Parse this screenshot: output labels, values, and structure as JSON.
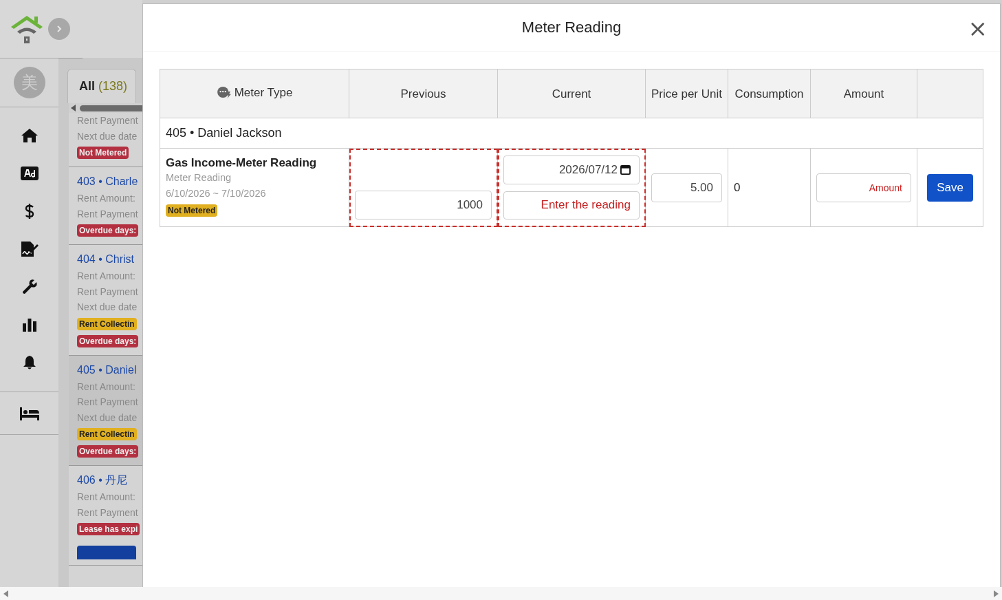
{
  "sidebar": {
    "avatar": "美"
  },
  "list": {
    "tabs": [
      {
        "label": "All",
        "count": "(138)",
        "selected": true
      }
    ],
    "cards": [
      {
        "lines": [
          "Rent Payment",
          "Next due date"
        ],
        "badges": [
          {
            "label": "Not Metered",
            "kind": "danger"
          }
        ],
        "selected": false,
        "button": false
      },
      {
        "title": "403 • Charle",
        "lines": [
          "Rent Amount:",
          "Rent Payment"
        ],
        "badges": [
          {
            "label": "Overdue days:",
            "kind": "danger"
          }
        ],
        "selected": false,
        "button": false
      },
      {
        "title": "404 • Christ",
        "lines": [
          "Rent Amount:",
          "Rent Payment",
          "Next due date"
        ],
        "badges": [
          {
            "label": "Rent Collectin",
            "kind": "warning"
          },
          {
            "label": "Overdue days:",
            "kind": "danger"
          }
        ],
        "selected": false,
        "button": false
      },
      {
        "title": "405 • Daniel",
        "lines": [
          "Rent Amount:",
          "Rent Payment",
          "Next due date"
        ],
        "badges": [
          {
            "label": "Rent Collectin",
            "kind": "warning"
          },
          {
            "label": "Overdue days:",
            "kind": "danger"
          }
        ],
        "selected": true,
        "button": false
      },
      {
        "title": "406 • 丹尼",
        "lines": [
          "Rent Amount:",
          "Rent Payment"
        ],
        "badges": [
          {
            "label": "Lease has expi",
            "kind": "danger"
          }
        ],
        "selected": false,
        "button": true
      }
    ]
  },
  "modal": {
    "title": "Meter Reading",
    "close": "×",
    "table": {
      "columns": [
        "Meter Type",
        "Previous",
        "Current",
        "Price per Unit",
        "Consumption",
        "Amount"
      ],
      "groups": [
        {
          "title": "405 • Daniel Jackson",
          "rows": [
            {
              "name": "Gas Income-Meter Reading",
              "subtitle": "Meter Reading",
              "period": "6/10/2026 ~ 7/10/2026",
              "badge": {
                "label": "Not Metered",
                "kind": "warning"
              },
              "previous": "1000",
              "current_date": "2026/07/12",
              "current_placeholder": "Enter the reading",
              "reading_error": true,
              "price": "5.00",
              "consumption": "0",
              "amount_placeholder": "Amount",
              "button": "Save"
            }
          ]
        }
      ]
    }
  }
}
